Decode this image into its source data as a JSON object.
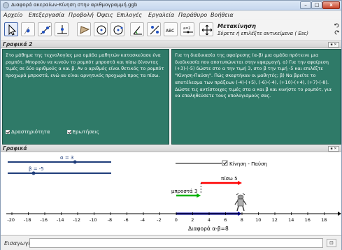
{
  "window": {
    "title": "Διαφορά ακεραίων-Κίνηση στην αριθμογραμμή.ggb",
    "controls": {
      "minimize": "–",
      "maximize": "□",
      "close": "x"
    }
  },
  "menu": {
    "items": [
      "Αρχείο",
      "Επεξεργασία",
      "Προβολή",
      "Όψεις",
      "Επιλογές",
      "Εργαλεία",
      "Παράθυρο",
      "Βοήθεια"
    ]
  },
  "toolbar": {
    "tools": [
      "move-tool-icon",
      "point-tool-icon",
      "line-tool-icon",
      "perpendicular-tool-icon",
      "polygon-tool-icon",
      "circle-tool-icon",
      "circle-center-tool-icon",
      "angle-tool-icon",
      "reflect-tool-icon",
      "text-tool-icon",
      "slider-tool-icon",
      "move-view-tool-icon"
    ],
    "text_tool_label": "ABC",
    "slider_tool_label": "a=2",
    "active_title": "Μετακίνηση",
    "active_hint": "Σύρετε ή επιλέξτε αντικείμενα ( Esc)"
  },
  "panel2": {
    "header": "Γραφικά 2",
    "left_text": "Στο μάθημα της τεχνολογίας μια ομάδα μαθητών κατασκεύασε ένα ρομπότ. Μπορούν να κινούν το ρομπότ μπροστά και πίσω δίνοντας τιμές σε δύο αριθμούς α και β. Αν ο αριθμός είναι θετικός το ρομπότ προχωρά μπροστά, ενώ αν είναι αρνητικός προχωρά προς τα πίσω.",
    "checkbox_activity": "Δραστηριότητα",
    "checkbox_questions": "Ερωτήσεις",
    "right_text": "Για τη διαδικασία της αφαίρεσης (α-β) μια ομάδα πρότεινε μια διαδικασία που αποτυπώνεται στην εφαρμογή. α) Για την αφαίρεση (+3)-(-5) δώστε στο α την τιμή 3, στο β την τιμή -5 και επιλέξτε \"Κίνηση-Παύση\". Πώς σκεφτήκαν οι μαθητές; β) Να βρείτε το αποτέλεσμα των πράξεων (-4)-(+5), (-6)-(-4), (+10)-(+4), (+7)-(-8). Δώστε τις αντίστοιχες τιμές στα α και β και κινήστε το ρομπότ, για να επαληθεύσετε τους υπολογισμούς σας."
  },
  "graphics": {
    "header": "Γραφικά",
    "slider_a_label": "α = 3",
    "slider_b_label": "β = -5",
    "slider_a_value": 3,
    "slider_b_value": -5,
    "motion_checkbox_label": "Κίνηση - Παύση",
    "back_label": "πίσω 5",
    "forward_label": "μπροστά 3",
    "result_label": "Διαφορά α-β=8",
    "axis_ticks": [
      "-20",
      "-18",
      "-16",
      "-14",
      "-12",
      "-10",
      "-8",
      "-6",
      "-4",
      "-2",
      "0",
      "2",
      "4",
      "6",
      "8",
      "10",
      "12",
      "14",
      "16",
      "18"
    ],
    "axis_min": -20,
    "axis_max": 20,
    "colors": {
      "forward": "#00b400",
      "back": "#ff0000",
      "result": "#0000a0",
      "slider": "#1f3d7a"
    }
  },
  "inputbar": {
    "label": "Εισαγωγή:",
    "value": "",
    "button": "⊡"
  }
}
